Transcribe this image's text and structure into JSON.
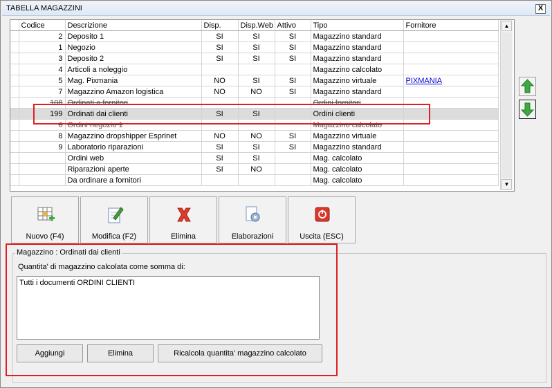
{
  "window": {
    "title": "TABELLA MAGAZZINI",
    "close_label": "X"
  },
  "table": {
    "columns": [
      "Codice",
      "Descrizione",
      "Disp.",
      "Disp.Web",
      "Attivo",
      "Tipo",
      "Fornitore"
    ],
    "rows": [
      {
        "codice": "2",
        "descrizione": "Deposito 1",
        "disp": "SI",
        "disp_web": "SI",
        "attivo": "SI",
        "tipo": "Magazzino standard",
        "fornitore": ""
      },
      {
        "codice": "1",
        "descrizione": "Negozio",
        "disp": "SI",
        "disp_web": "SI",
        "attivo": "SI",
        "tipo": "Magazzino standard",
        "fornitore": ""
      },
      {
        "codice": "3",
        "descrizione": "Deposito 2",
        "disp": "SI",
        "disp_web": "SI",
        "attivo": "SI",
        "tipo": "Magazzino standard",
        "fornitore": ""
      },
      {
        "codice": "4",
        "descrizione": "Articoli a noleggio",
        "disp": "",
        "disp_web": "",
        "attivo": "",
        "tipo": "Magazzino calcolato",
        "fornitore": ""
      },
      {
        "codice": "5",
        "descrizione": "Mag. Pixmania",
        "disp": "NO",
        "disp_web": "SI",
        "attivo": "SI",
        "tipo": "Magazzino virtuale",
        "fornitore": "PIXMANIA"
      },
      {
        "codice": "7",
        "descrizione": "Magazzino Amazon logistica",
        "disp": "NO",
        "disp_web": "NO",
        "attivo": "SI",
        "tipo": "Magazzino standard",
        "fornitore": ""
      },
      {
        "codice": "108",
        "descrizione": "Ordinati a fornitori",
        "disp": "",
        "disp_web": "",
        "attivo": "",
        "tipo": "Ordini fornitori",
        "fornitore": ""
      },
      {
        "codice": "199",
        "descrizione": "Ordinati dai clienti",
        "disp": "SI",
        "disp_web": "SI",
        "attivo": "",
        "tipo": "Ordini clienti",
        "fornitore": ""
      },
      {
        "codice": "6",
        "descrizione": "Ordini negozio 1",
        "disp": "",
        "disp_web": "",
        "attivo": "",
        "tipo": "Magazzino calcolato",
        "fornitore": ""
      },
      {
        "codice": "8",
        "descrizione": "Magazzino dropshipper Esprinet",
        "disp": "NO",
        "disp_web": "NO",
        "attivo": "SI",
        "tipo": "Magazzino virtuale",
        "fornitore": ""
      },
      {
        "codice": "9",
        "descrizione": "Laboratorio riparazioni",
        "disp": "SI",
        "disp_web": "SI",
        "attivo": "SI",
        "tipo": "Magazzino standard",
        "fornitore": ""
      },
      {
        "codice": "",
        "descrizione": "Ordini web",
        "disp": "SI",
        "disp_web": "SI",
        "attivo": "",
        "tipo": "Mag. calcolato",
        "fornitore": ""
      },
      {
        "codice": "",
        "descrizione": "Riparazioni aperte",
        "disp": "SI",
        "disp_web": "NO",
        "attivo": "",
        "tipo": "Mag. calcolato",
        "fornitore": ""
      },
      {
        "codice": "",
        "descrizione": "Da ordinare a fornitori",
        "disp": "",
        "disp_web": "",
        "attivo": "",
        "tipo": "Mag. calcolato",
        "fornitore": ""
      }
    ],
    "selected_index": 7
  },
  "toolbar": {
    "new_label": "Nuovo (F4)",
    "edit_label": "Modifica (F2)",
    "delete_label": "Elimina",
    "process_label": "Elaborazioni",
    "exit_label": "Uscita (ESC)"
  },
  "detail": {
    "group_title": "Magazzino : Ordinati dai clienti",
    "subtitle": "Quantita' di magazzino calcolata come somma di:",
    "memo_text": "Tutti i documenti ORDINI CLIENTI",
    "add_label": "Aggiungi",
    "remove_label": "Elimina",
    "recalc_label": "Ricalcola quantita' magazzino calcolato"
  },
  "colors": {
    "highlight": "#e02020",
    "up_arrow": "#3faa3f",
    "delete_icon": "#e03b2a",
    "exit_icon": "#d9372b"
  }
}
